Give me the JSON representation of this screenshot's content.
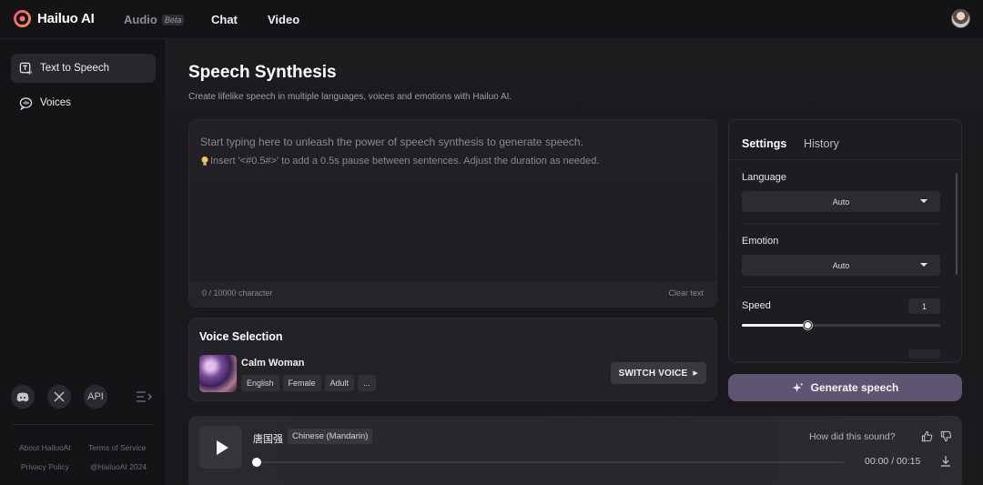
{
  "app": {
    "brand": "Hailuo AI",
    "nav": {
      "audio": "Audio",
      "beta": "Beta",
      "chat": "Chat",
      "video": "Video"
    }
  },
  "sidebar": {
    "items": [
      {
        "label": "Text to Speech",
        "icon": "text-to-speech-icon",
        "active": true
      },
      {
        "label": "Voices",
        "icon": "voices-icon",
        "active": false
      }
    ],
    "social": {
      "api": "API"
    },
    "footer": {
      "about": "About HailuoAI",
      "terms": "Terms of Service",
      "privacy": "Privacy Policy",
      "copyright": "@HailuoAI 2024"
    }
  },
  "main": {
    "title": "Speech Synthesis",
    "subtitle": "Create lifelike speech in multiple languages, voices and emotions with Hailuo AI.",
    "editor": {
      "placeholder": "Start typing here to unleash the power of speech synthesis to generate speech.",
      "hint": "Insert '<#0.5#>' to add a 0.5s pause between sentences. Adjust the duration as needed.",
      "char_count": "0 / 10000 character",
      "clear": "Clear text"
    },
    "voice": {
      "section_title": "Voice Selection",
      "name": "Calm Woman",
      "tags": [
        "English",
        "Female",
        "Adult",
        "..."
      ],
      "switch_label": "SWITCH VOICE"
    }
  },
  "settings": {
    "tabs": [
      "Settings",
      "History"
    ],
    "language_label": "Language",
    "language_value": "Auto",
    "emotion_label": "Emotion",
    "emotion_value": "Auto",
    "speed_label": "Speed",
    "speed_value": "1",
    "speed_slider_fraction": 0.33
  },
  "generate_label": "Generate speech",
  "player": {
    "title": "唐国强",
    "language": "Chinese (Mandarin)",
    "feedback_question": "How did this sound?",
    "time": "00:00 / 00:15",
    "progress_fraction": 0
  },
  "colors": {
    "background": "#181719",
    "accent_button": "#5e5670"
  }
}
